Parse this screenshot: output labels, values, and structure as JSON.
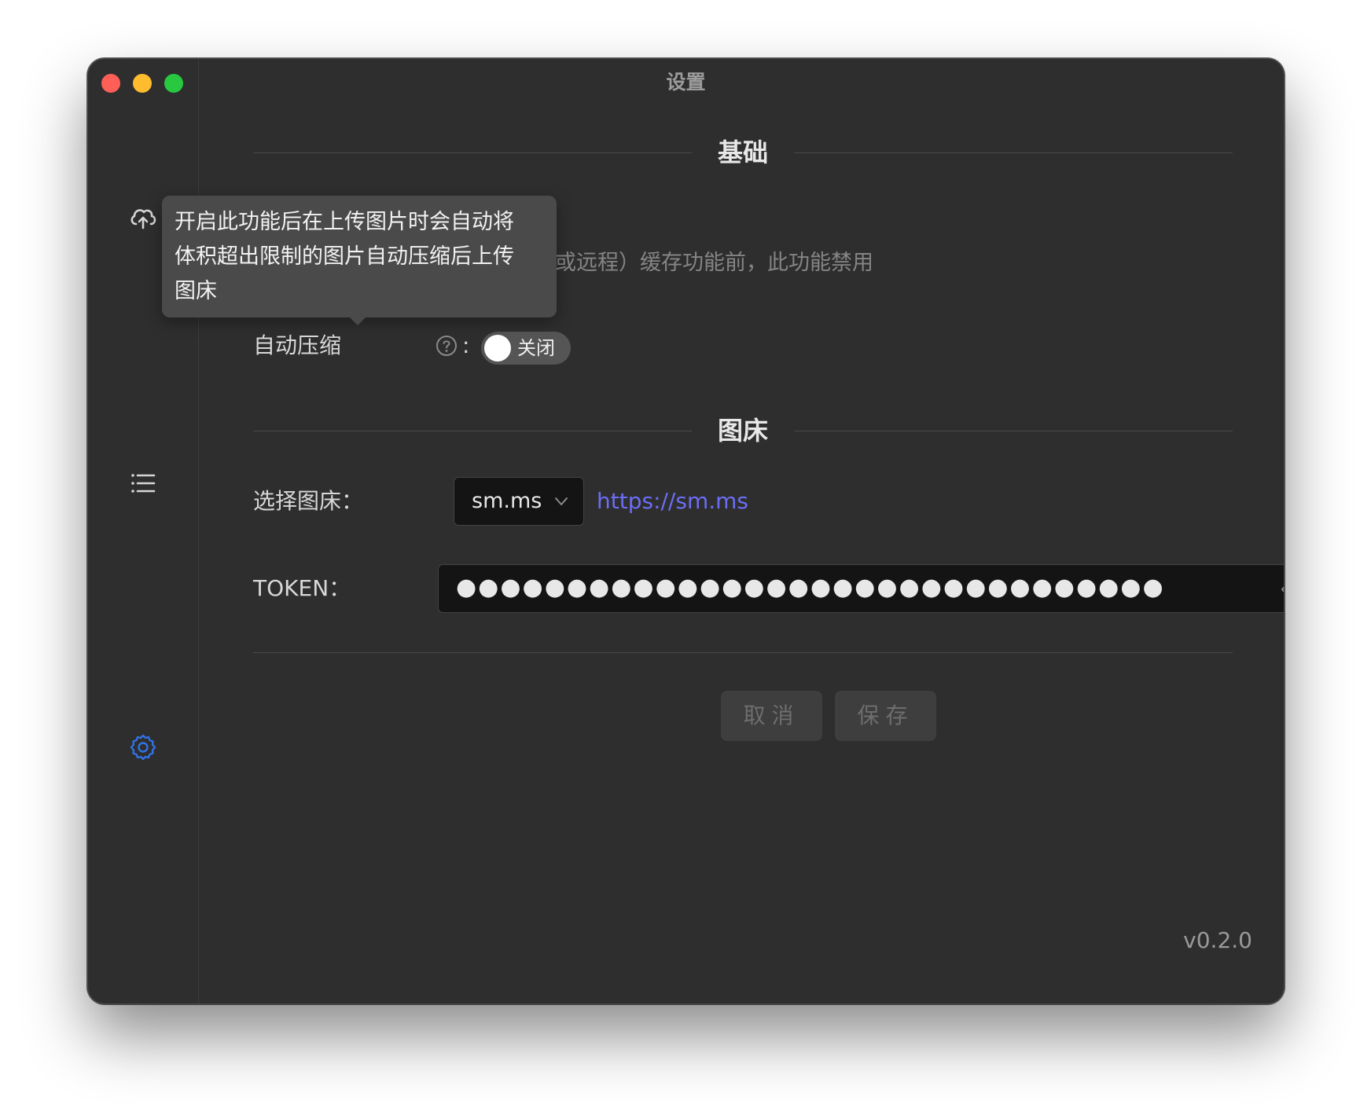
{
  "window": {
    "title": "设置"
  },
  "sidebar": {
    "items": [
      {
        "icon": "cloud-upload-icon",
        "active": false
      },
      {
        "icon": "list-icon",
        "active": false
      },
      {
        "icon": "gear-icon",
        "active": true
      }
    ],
    "active_color": "#2f73e8",
    "icon_color": "#d6d6d6"
  },
  "basic": {
    "heading": "基础",
    "hint_text": "或远程）缓存功能前，此功能禁用",
    "auto_compress_label": "自动压缩",
    "colon": ":",
    "toggle_label": "关闭"
  },
  "tooltip": {
    "text_line1": "开启此功能后在上传图片时会自动将",
    "text_line2": "体积超出限制的图片自动压缩后上传",
    "text_line3": "图床"
  },
  "image_host": {
    "heading": "图床",
    "select_label": "选择图床：",
    "selected_value": "sm.ms",
    "link_text": "https://sm.ms",
    "link_color": "#6b6ef5",
    "token_label": "TOKEN：",
    "token_masked": "●●●●●●●●●●●●●●●●●●●●●●●●●●●●●●●●"
  },
  "actions": {
    "cancel_label": "取消",
    "save_label": "保存"
  },
  "footer": {
    "version": "v0.2.0"
  }
}
